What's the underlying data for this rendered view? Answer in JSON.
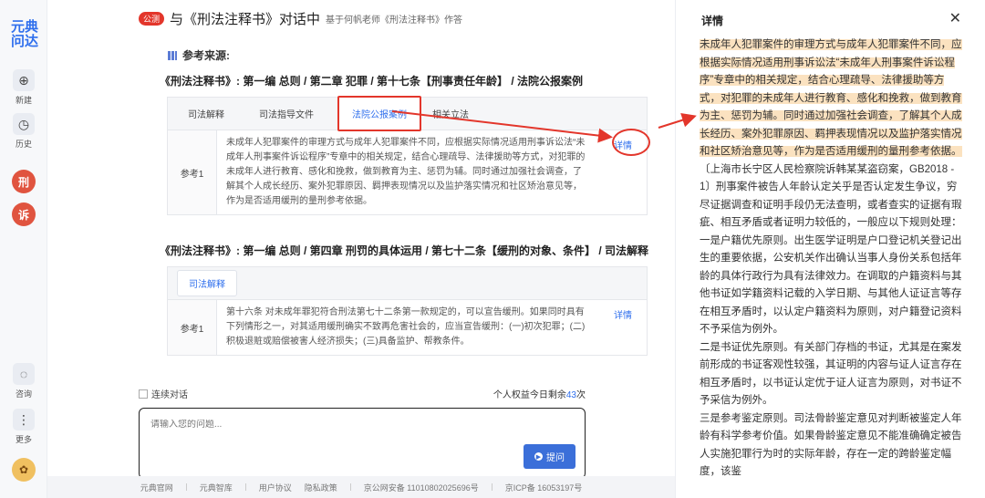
{
  "rail": {
    "logo": [
      "元典",
      "问达"
    ],
    "new_label": "新建",
    "history_label": "历史",
    "criminal_badge": "刑",
    "litigation_badge": "诉",
    "consult_label": "咨询",
    "more_label": "更多"
  },
  "header": {
    "public_tag": "公测",
    "title": "与《刑法注释书》对话中",
    "subtitle": "基于何帆老师《刑法注释书》作答"
  },
  "refs": {
    "heading": "参考来源:",
    "block1": {
      "crumb": "《刑法注释书》: 第一编 总则 / 第二章 犯罪 / 第十七条【刑事责任年龄】 / 法院公报案例",
      "tabs": [
        "司法解释",
        "司法指导文件",
        "法院公报案例",
        "相关立法"
      ],
      "row_label": "参考1",
      "row_text": "未成年人犯罪案件的审理方式与成年人犯罪案件不同，应根据实际情况适用刑事诉讼法“未成年人刑事案件诉讼程序”专章中的相关规定，结合心理疏导、法律援助等方式，对犯罪的未成年人进行教育、感化和挽救，做到教育为主、惩罚为辅。同时通过加强社会调查，了解其个人成长经历、案外犯罪原因、羁押表现情况以及监护落实情况和社区矫治意见等，作为是否适用缓刑的量刑参考依据。",
      "link": "详情"
    },
    "block2": {
      "crumb": "《刑法注释书》: 第一编 总则 / 第四章 刑罚的具体运用 / 第七十二条【缓刑的对象、条件】 / 司法解释",
      "tabs": [
        "司法解释"
      ],
      "row_label": "参考1",
      "row_text": "第十六条 对未成年罪犯符合刑法第七十二条第一款规定的，可以宣告缓刑。如果同时具有下列情形之一，对其适用缓刑确实不致再危害社会的，应当宣告缓刑：(一)初次犯罪；(二)积极退赃或赔偿被害人经济损失；(三)具备监护、帮教条件。",
      "link": "详情"
    }
  },
  "chat": {
    "continuous_label": "连续对话",
    "quota_prefix": "个人权益今日剩余",
    "quota_count": "43",
    "quota_suffix": "次",
    "placeholder": "请输入您的问题...",
    "ask_label": "提问"
  },
  "footer": {
    "links": [
      "元典官网",
      "元典智库",
      "用户协议",
      "隐私政策"
    ],
    "icp1": "京公网安备 11010802025696号",
    "icp2": "京ICP备 16053197号"
  },
  "panel": {
    "title": "详情",
    "highlight": "未成年人犯罪案件的审理方式与成年人犯罪案件不同，应根据实际情况适用刑事诉讼法“未成年人刑事案件诉讼程序”专章中的相关规定，结合心理疏导、法律援助等方式，对犯罪的未成年人进行教育、感化和挽救，做到教育为主、惩罚为辅。同时通过加强社会调查，了解其个人成长经历、案外犯罪原因、羁押表现情况以及监护落实情况和社区矫治意见等，作为是否适用缓刑的量刑参考依据。",
    "p1": "〔上海市长宁区人民检察院诉韩某某盗窃案，GB2018 - 1〕刑事案件被告人年龄认定关乎是否认定发生争议，穷尽证据调查和证明手段仍无法查明，或者查实的证据有瑕疵、相互矛盾或者证明力较低的，一般应以下规则处理：",
    "p2": "一是户籍优先原则。出生医学证明是户口登记机关登记出生的重要依据，公安机关作出确认当事人身份关系包括年龄的具体行政行为具有法律效力。在调取的户籍资料与其他书证如学籍资料记载的入学日期、与其他人证证言等存在相互矛盾时，以认定户籍资料为原则，对户籍登记资料不予采信为例外。",
    "p3": "二是书证优先原则。有关部门存档的书证，尤其是在案发前形成的书证客观性较强，其证明的内容与证人证言存在相互矛盾时，以书证认定优于证人证言为原则，对书证不予采信为例外。",
    "p4": "三是参考鉴定原则。司法骨龄鉴定意见对判断被鉴定人年龄有科学参考价值。如果骨龄鉴定意见不能准确确定被告人实施犯罪行为时的实际年龄，存在一定的跨龄鉴定幅度，该鉴"
  }
}
